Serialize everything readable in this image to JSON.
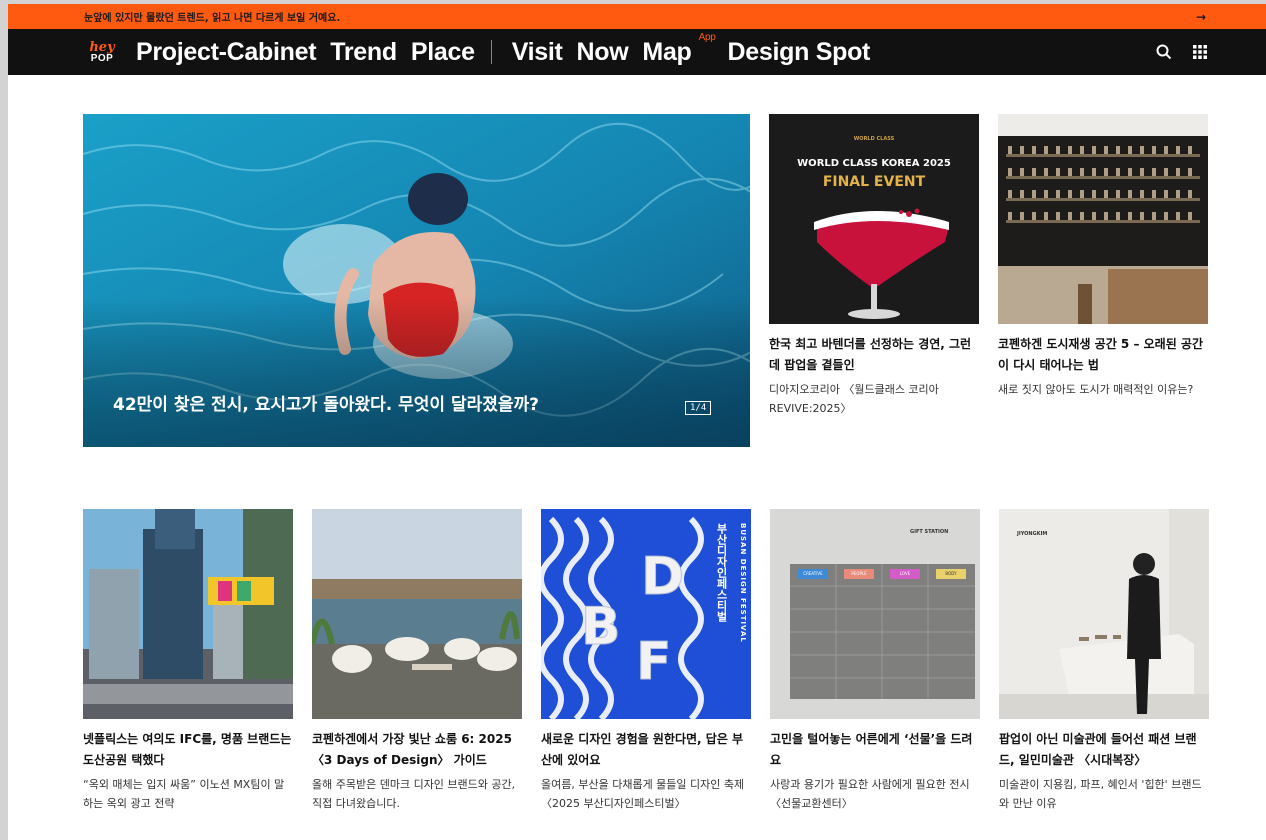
{
  "topbar": {
    "message": "눈앞에 있지만 몰랐던 트렌드, 읽고 나면 다르게 보일 거예요.",
    "arrow": "→"
  },
  "nav": {
    "logo_top": "hey",
    "logo_bottom": "POP",
    "items": [
      "Project-Cabinet",
      "Trend",
      "Place",
      "Visit",
      "Now",
      "Map",
      "Design Spot"
    ],
    "app_badge": "App",
    "icons": [
      "search-icon",
      "grid-menu-icon"
    ]
  },
  "hero": {
    "title": "42만이 찾은 전시, 요시고가 돌아왔다. 무엇이 달라졌을까?",
    "pager": "1/4"
  },
  "cards_top": [
    {
      "image_text_1": "WORLD CLASS",
      "image_text_2": "WORLD CLASS KOREA 2025",
      "image_text_3": "FINAL EVENT",
      "title": "한국 최고 바텐더를 선정하는 경연, 그런데 팝업을 곁들인",
      "desc": "디아지오코리아 〈월드클래스 코리아 REVIVE:2025〉"
    },
    {
      "title": "코펜하겐 도시재생 공간 5 – 오래된 공간이 다시 태어나는 법",
      "desc": "새로 짓지 않아도 도시가 매력적인 이유는?"
    }
  ],
  "cards_bottom": [
    {
      "title": "넷플릭스는 여의도 IFC를, 명품 브랜드는 도산공원 택했다",
      "desc": "“옥외 매체는 입지 싸움” 이노션 MX팀이 말하는 옥외 광고 전략"
    },
    {
      "title": "코펜하겐에서 가장 빛난 쇼룸 6: 2025 〈3 Days of Design〉 가이드",
      "desc": "올해 주목받은 덴마크 디자인 브랜드와 공간, 직접 다녀왔습니다."
    },
    {
      "image_text_1": "BUSAN DESIGN FESTIVAL",
      "image_text_2": "부산디자인페스티벌",
      "image_text_3": "BDF",
      "title": "새로운 디자인 경험을 원한다면, 답은 부산에 있어요",
      "desc": "올여름, 부산을 다채롭게 물들일 디자인 축제 〈2025 부산디자인페스티벌〉"
    },
    {
      "image_text_1": "GIFT STATION",
      "image_labels": [
        "CREATIVE",
        "PEOPLE",
        "LOVE",
        "BODY"
      ],
      "title": "고민을 털어놓는 어른에게 ‘선물’을 드려요",
      "desc": "사랑과 용기가 필요한 사람에게 필요한 전시 〈선물교환센터〉"
    },
    {
      "image_text_1": "JIYONGKIM",
      "title": "팝업이 아닌 미술관에 들어선 패션 브랜드, 일민미술관 〈시대복장〉",
      "desc": "미술관이 지용킴, 파프, 혜인서 '힙한' 브랜드와 만난 이유"
    }
  ]
}
